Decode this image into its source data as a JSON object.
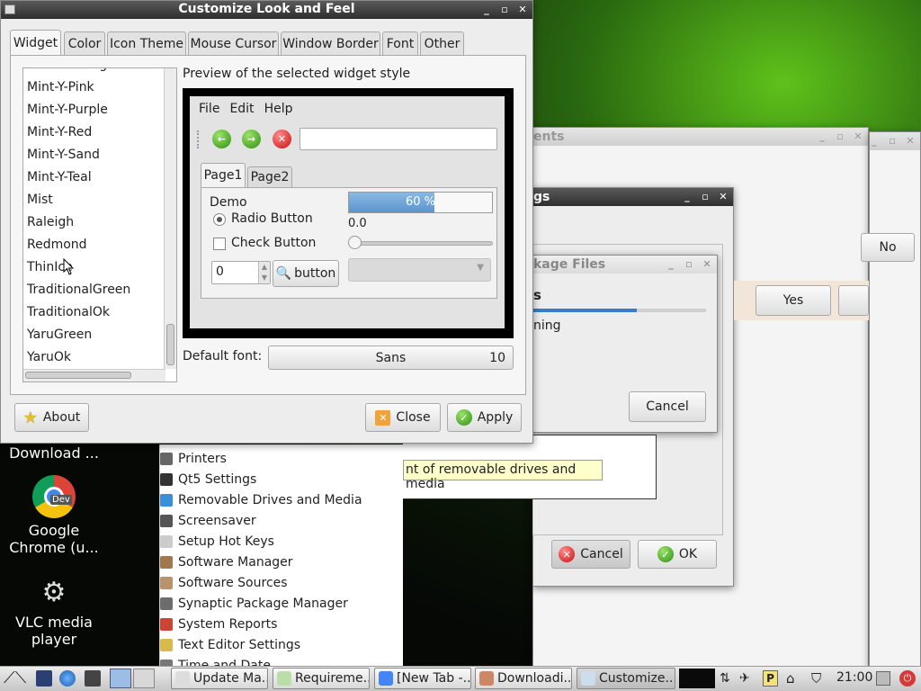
{
  "dialog": {
    "title": "Customize Look and Feel",
    "tabs": [
      "Widget",
      "Color",
      "Icon Theme",
      "Mouse Cursor",
      "Window Border",
      "Font",
      "Other"
    ],
    "theme_list": [
      "Mint-Y-Orange",
      "Mint-Y-Pink",
      "Mint-Y-Purple",
      "Mint-Y-Red",
      "Mint-Y-Sand",
      "Mint-Y-Teal",
      "Mist",
      "Raleigh",
      "Redmond",
      "ThinIce",
      "TraditionalGreen",
      "TraditionalOk",
      "YaruGreen",
      "YaruOk"
    ],
    "preview_label": "Preview of the selected widget style",
    "preview": {
      "menu": [
        "File",
        "Edit",
        "Help"
      ],
      "tabs": [
        "Page1",
        "Page2"
      ],
      "demo_label": "Demo",
      "radio_label": "Radio Button",
      "check_label": "Check Button",
      "spin_value": "0",
      "button_label": "button",
      "progress_text": "60 %",
      "progress_fraction": 0.6,
      "scale_value": "0.0"
    },
    "default_font_label": "Default font:",
    "font_name": "Sans",
    "font_size": "10",
    "about_label": "About",
    "close_label": "Close",
    "apply_label": "Apply"
  },
  "bg_windows": {
    "w1_title": "ents",
    "w2_title": "gs",
    "w3_title": "kage Files",
    "w3_heading": "s",
    "w3_status": "ning",
    "w3_progress_fraction": 0.6,
    "w3_cancel": "Cancel",
    "w2_no": "No",
    "w2_yes": "Yes",
    "tooltip": "nt of removable drives and media",
    "cancel_label": "Cancel",
    "ok_label": "OK"
  },
  "menu_items": [
    "Printers",
    "Qt5 Settings",
    "Removable Drives and Media",
    "Screensaver",
    "Setup Hot Keys",
    "Software Manager",
    "Software Sources",
    "Synaptic Package Manager",
    "System Reports",
    "Text Editor Settings",
    "Time and Date"
  ],
  "desktop_icons": [
    {
      "label": "Download ..."
    },
    {
      "label": "Google Chrome (u...",
      "badge": "Dev"
    },
    {
      "label": "VLC media player"
    }
  ],
  "taskbar": {
    "tasks": [
      "Update Ma...",
      "Requireme...",
      "[New Tab -...",
      "Downloadi...",
      "Customize..."
    ],
    "clock": "21:00"
  }
}
